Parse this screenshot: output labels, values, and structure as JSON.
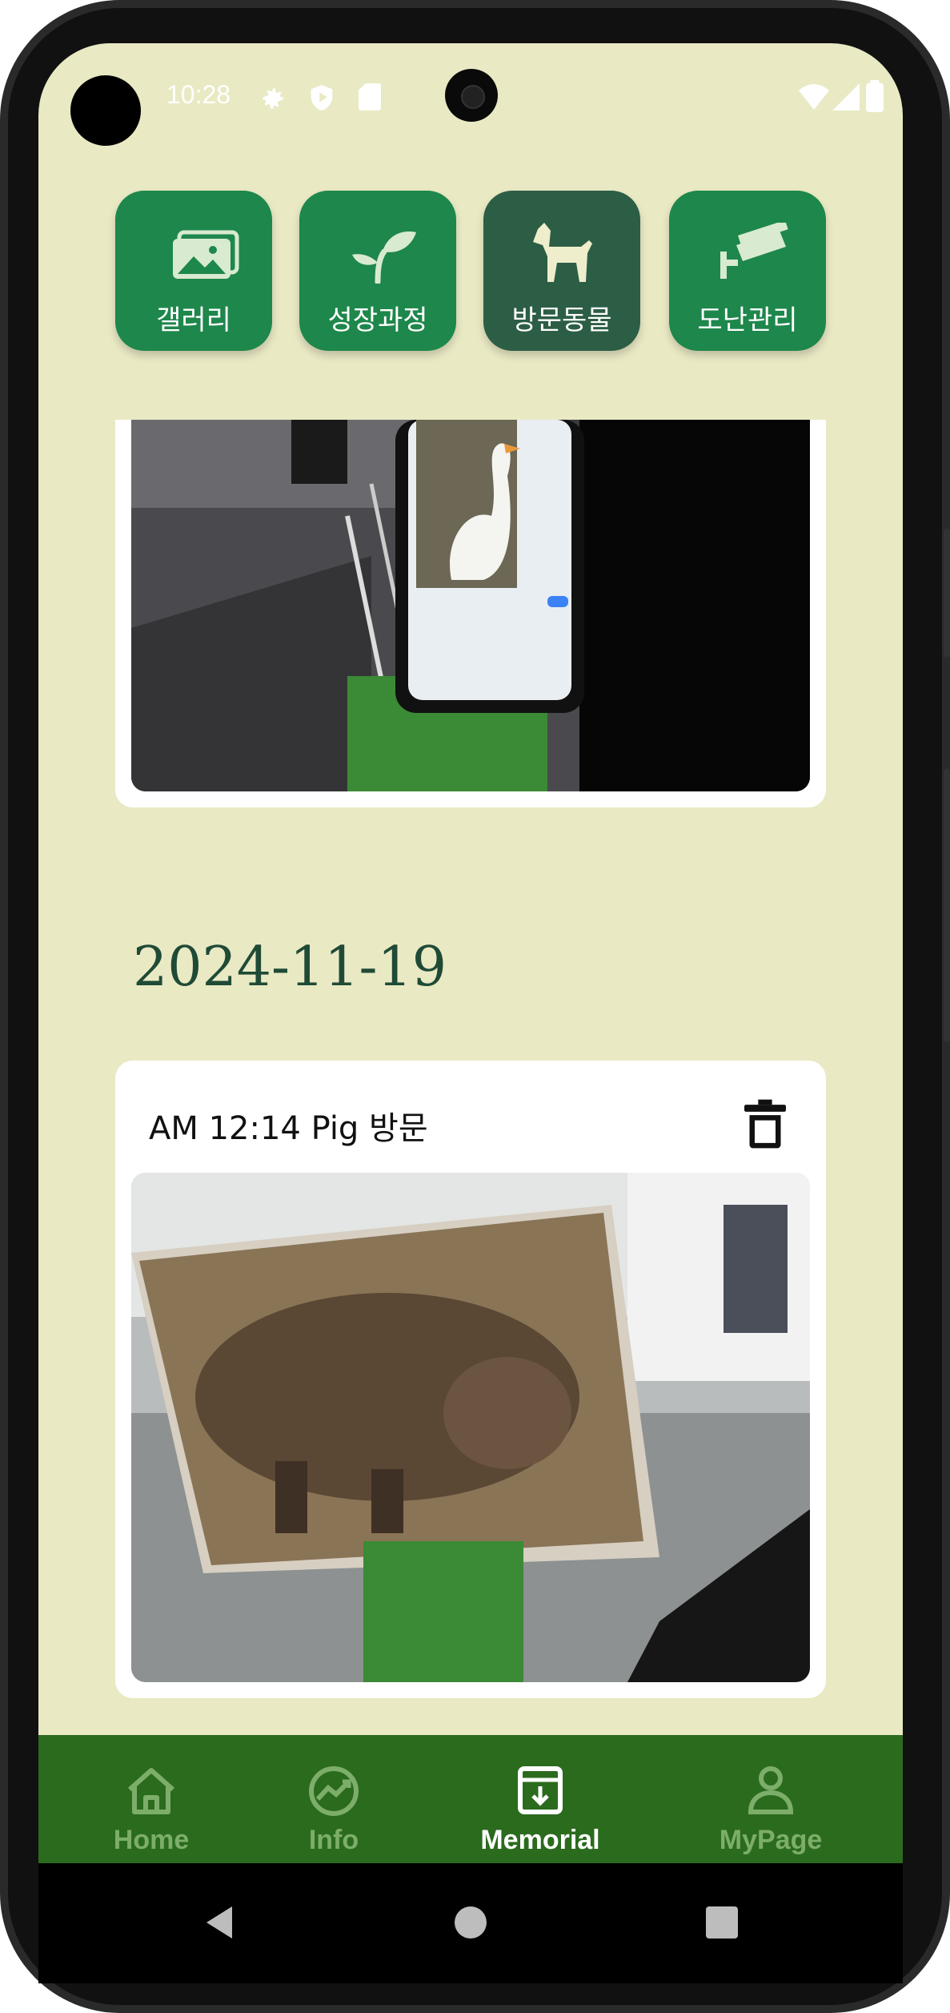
{
  "status_bar": {
    "time": "10:28"
  },
  "categories": [
    {
      "label": "갤러리",
      "icon": "gallery-icon",
      "active": false
    },
    {
      "label": "성장과정",
      "icon": "sprout-icon",
      "active": false
    },
    {
      "label": "방문동물",
      "icon": "dog-icon",
      "active": true
    },
    {
      "label": "도난관리",
      "icon": "cctv-icon",
      "active": false
    }
  ],
  "entries": [
    {
      "date": "2024-11-19",
      "title": "AM 12:14 Pig 방문"
    }
  ],
  "bottom_nav": [
    {
      "label": "Home",
      "icon": "home-icon",
      "active": false
    },
    {
      "label": "Info",
      "icon": "chart-icon",
      "active": false
    },
    {
      "label": "Memorial",
      "icon": "archive-icon",
      "active": true
    },
    {
      "label": "MyPage",
      "icon": "person-icon",
      "active": false
    }
  ],
  "colors": {
    "background": "#e9e9c4",
    "category_button": "#1e874b",
    "category_button_active": "#2c5e45",
    "bottom_nav": "#2b6b1e",
    "date_text": "#1f4a36"
  }
}
